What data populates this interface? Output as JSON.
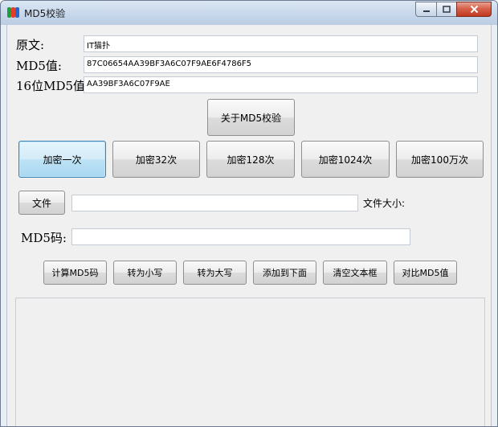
{
  "window": {
    "title": "MD5校验",
    "controls": {
      "minimize": "–",
      "maximize": "□",
      "close": "✕"
    }
  },
  "inputs": {
    "original_label": "原文:",
    "original_value": "IT猫扑",
    "md5_label": "MD5值:",
    "md5_value": "87C06654AA39BF3A6C07F9AE6F4786F5",
    "md5_16_label": "16位MD5值:",
    "md5_16_value": "AA39BF3A6C07F9AE"
  },
  "about_button": "关于MD5校验",
  "encrypt_buttons": [
    "加密一次",
    "加密32次",
    "加密128次",
    "加密1024次",
    "加密100万次"
  ],
  "file": {
    "button": "文件",
    "path_value": "",
    "size_label": "文件大小:",
    "md5_code_label": "MD5码:",
    "md5_code_value": ""
  },
  "action_buttons": [
    "计算MD5码",
    "转为小写",
    "转为大写",
    "添加到下面",
    "清空文本框",
    "对比MD5值"
  ],
  "output_text": ""
}
